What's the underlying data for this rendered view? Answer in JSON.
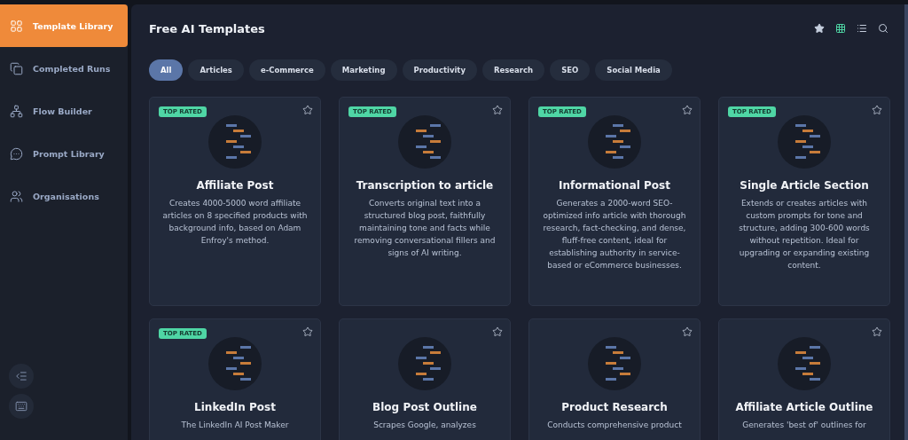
{
  "sidebar": {
    "items": [
      {
        "label": "Template Library",
        "selected": true
      },
      {
        "label": "Completed Runs",
        "selected": false
      },
      {
        "label": "Flow Builder",
        "selected": false
      },
      {
        "label": "Prompt Library",
        "selected": false
      },
      {
        "label": "Organisations",
        "selected": false
      }
    ]
  },
  "header": {
    "title": "Free AI Templates",
    "view_options": [
      {
        "kind": "grid",
        "selected": true
      },
      {
        "kind": "list",
        "selected": false
      }
    ]
  },
  "filters": [
    {
      "label": "All",
      "selected": true
    },
    {
      "label": "Articles",
      "selected": false
    },
    {
      "label": "e-Commerce",
      "selected": false
    },
    {
      "label": "Marketing",
      "selected": false
    },
    {
      "label": "Productivity",
      "selected": false
    },
    {
      "label": "Research",
      "selected": false
    },
    {
      "label": "SEO",
      "selected": false
    },
    {
      "label": "Social Media",
      "selected": false
    }
  ],
  "templates": [
    {
      "title": "Affiliate Post",
      "badge": "TOP RATED",
      "favorite": false,
      "description": "Creates 4000-5000 word affiliate articles on 8 specified products with background info, based on Adam Enfroy's method."
    },
    {
      "title": "Transcription to article",
      "badge": "TOP RATED",
      "favorite": false,
      "description": "Converts original text into a structured blog post, faithfully maintaining tone and facts while removing conversational fillers and signs of AI writing."
    },
    {
      "title": "Informational Post",
      "badge": "TOP RATED",
      "favorite": false,
      "description": "Generates a 2000-word SEO-optimized info article with thorough research, fact-checking, and dense, fluff-free content, ideal for establishing authority in service-based or eCommerce businesses."
    },
    {
      "title": "Single Article Section",
      "badge": "TOP RATED",
      "favorite": false,
      "description": "Extends or creates articles with custom prompts for tone and structure, adding 300-600 words without repetition. Ideal for upgrading or expanding existing content."
    },
    {
      "title": "LinkedIn Post",
      "badge": "TOP RATED",
      "favorite": false,
      "description": "The LinkedIn AI Post Maker"
    },
    {
      "title": "Blog Post Outline",
      "favorite": false,
      "description": "Scrapes Google, analyzes"
    },
    {
      "title": "Product Research",
      "favorite": false,
      "description": "Conducts comprehensive product"
    },
    {
      "title": "Affiliate Article Outline",
      "favorite": false,
      "description": "Generates 'best of' outlines for"
    }
  ]
}
